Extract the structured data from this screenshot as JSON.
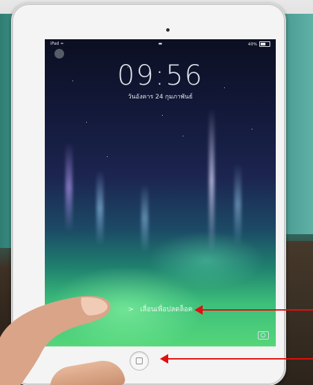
{
  "lock_screen": {
    "time": "09:56",
    "date": "วันอังคาร 24 กุมภาพันธ์",
    "unlock_label": "เลื่อนเพื่อปลดล็อค",
    "unlock_chevron": ">"
  },
  "status_bar": {
    "carrier": "iPad ≈",
    "battery": "40%"
  },
  "colors": {
    "annotation_arrow": "#e01010"
  }
}
